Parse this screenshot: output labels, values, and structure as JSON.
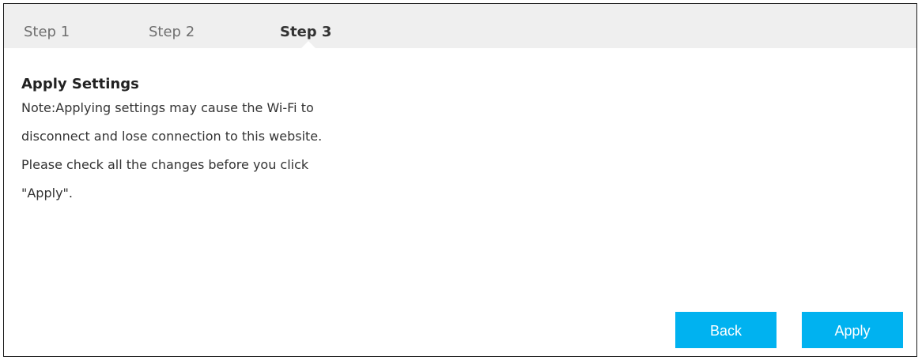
{
  "steps": [
    {
      "label": "Step 1",
      "active": false
    },
    {
      "label": "Step 2",
      "active": false
    },
    {
      "label": "Step 3",
      "active": true
    }
  ],
  "section": {
    "title": "Apply Settings",
    "note_lines": [
      "Note:Applying settings may cause the Wi-Fi to",
      "disconnect and lose connection to this website.",
      "Please check all the changes before you click",
      "\"Apply\"."
    ]
  },
  "buttons": {
    "back_label": "Back",
    "apply_label": "Apply"
  },
  "colors": {
    "accent": "#00b2f0",
    "step_bar_bg": "#efefef"
  }
}
